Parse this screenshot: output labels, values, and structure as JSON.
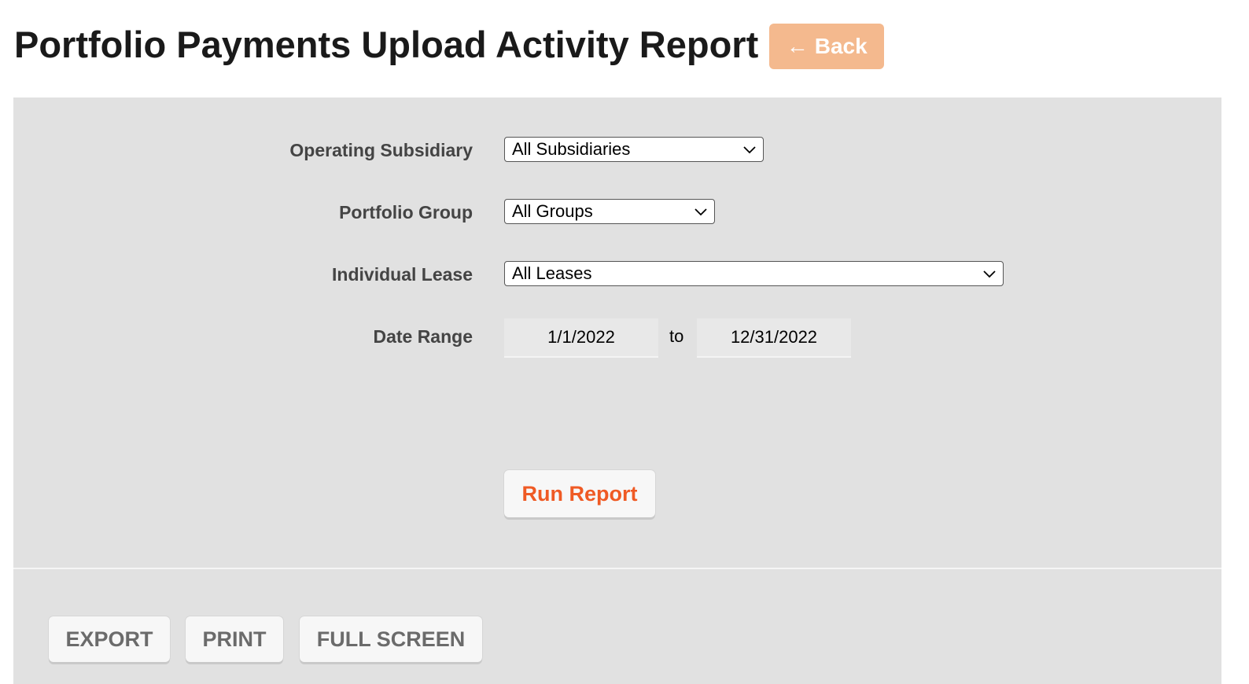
{
  "header": {
    "title": "Portfolio Payments Upload Activity Report",
    "back_arrow": "←",
    "back_label": "Back"
  },
  "form": {
    "subsidiary": {
      "label": "Operating Subsidiary",
      "value": "All Subsidiaries"
    },
    "group": {
      "label": "Portfolio Group",
      "value": "All Groups"
    },
    "lease": {
      "label": "Individual Lease",
      "value": "All Leases"
    },
    "date_range": {
      "label": "Date Range",
      "start": "1/1/2022",
      "separator": "to",
      "end": "12/31/2022"
    },
    "run_label": "Run Report"
  },
  "toolbar": {
    "export_label": "EXPORT",
    "print_label": "PRINT",
    "fullscreen_label": "FULL SCREEN"
  },
  "colors": {
    "back_button": "#f4b98e",
    "run_report_text": "#ef5a24",
    "panel_background": "#e1e1e1"
  },
  "icons": {
    "back": "left-arrow-icon",
    "select": "chevron-down-icon"
  }
}
